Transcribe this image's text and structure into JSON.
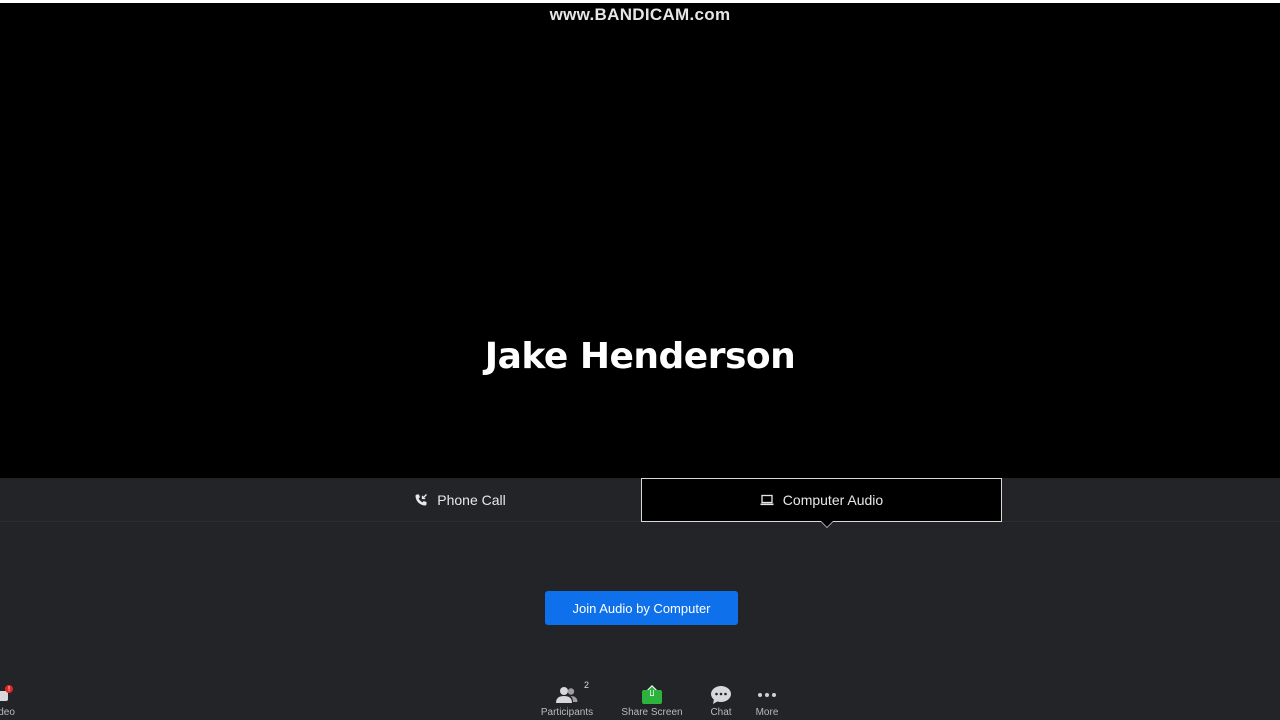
{
  "watermark": "www.BANDICAM.com",
  "participant": {
    "name": "Jake Henderson"
  },
  "audio": {
    "tabs": [
      {
        "label": "Phone Call",
        "icon": "phone-icon",
        "selected": false
      },
      {
        "label": "Computer Audio",
        "icon": "laptop-icon",
        "selected": true
      }
    ],
    "join_button": "Join Audio by Computer"
  },
  "toolbar": {
    "video": {
      "label": "ideo",
      "icon": "video-camera-icon",
      "alert": "!"
    },
    "participants": {
      "label": "Participants",
      "count": "2",
      "icon": "participants-icon"
    },
    "share": {
      "label": "Share Screen",
      "icon": "share-screen-icon",
      "color": "#2db23d"
    },
    "chat": {
      "label": "Chat",
      "icon": "chat-icon"
    },
    "more": {
      "label": "More",
      "icon": "more-icon"
    }
  },
  "colors": {
    "accent": "#0e71eb",
    "panel": "#232428",
    "video_bg": "#000000"
  }
}
